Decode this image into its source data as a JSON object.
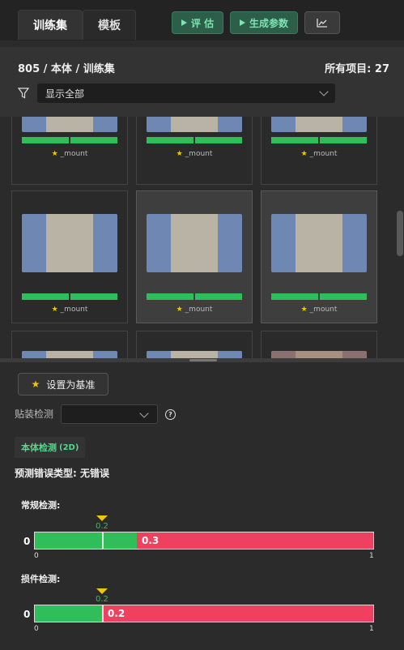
{
  "tabs": [
    {
      "label": "训练集",
      "active": true
    },
    {
      "label": "模板",
      "active": false
    }
  ],
  "toolbar": {
    "evaluate_label": "评 估",
    "generate_label": "生成参数",
    "chart_icon": "chart-icon"
  },
  "header": {
    "breadcrumb": "805 / 本体 / 训练集",
    "count_label": "所有项目: 27",
    "filter_value": "显示全部"
  },
  "gallery": {
    "card_label": "_mount",
    "rows": [
      {
        "cards": [
          {
            "selected": false
          },
          {
            "selected": false
          },
          {
            "selected": false
          }
        ]
      },
      {
        "cards": [
          {
            "selected": false
          },
          {
            "selected": true
          },
          {
            "selected": true
          }
        ]
      },
      {
        "cards": [
          {
            "selected": false
          },
          {
            "selected": false
          },
          {
            "selected": false
          }
        ]
      }
    ]
  },
  "panel": {
    "set_baseline_label": "设置为基准",
    "mount_detect_label": "贴装检测",
    "mount_detect_value": "",
    "help_glyph": "?",
    "subtab_label": "本体检测",
    "subtab_suffix": "(2D)",
    "prediction_text": "预测错误类型: 无错误",
    "gauges": [
      {
        "title": "常规检测:",
        "threshold": 0.2,
        "threshold_label": "0.2",
        "value": 0.3,
        "value_label": "0.3",
        "min_label": "0",
        "tick_min": "0",
        "tick_max": "1"
      },
      {
        "title": "损件检测:",
        "threshold": 0.2,
        "threshold_label": "0.2",
        "value": 0.2,
        "value_label": "0.2",
        "min_label": "0",
        "tick_min": "0",
        "tick_max": "1"
      }
    ]
  },
  "colors": {
    "accent_green": "#2fbe5a",
    "alert_red": "#f0405f",
    "marker_yellow": "#f1c40f"
  }
}
